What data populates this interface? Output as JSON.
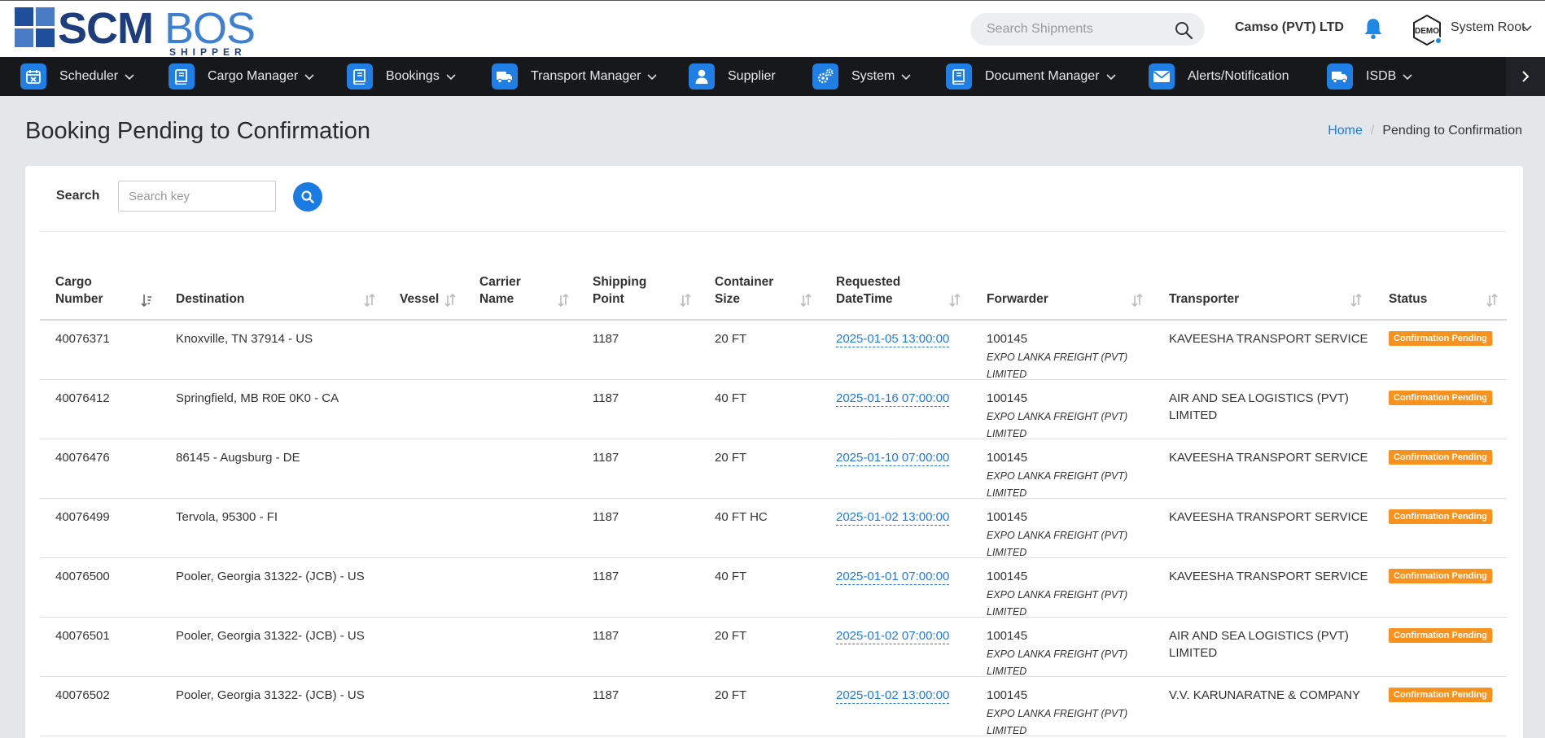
{
  "header": {
    "logo_main": "SCM",
    "logo_second": "BOS",
    "logo_sub": "SHIPPER",
    "search_placeholder": "Search Shipments",
    "company": "Camso (PVT) LTD",
    "demo_label": "DEMO",
    "user_name": "System Root"
  },
  "nav": {
    "items": [
      {
        "label": "Scheduler",
        "icon": "calendar-icon",
        "has_chevron": true
      },
      {
        "label": "Cargo Manager",
        "icon": "book-icon",
        "has_chevron": true
      },
      {
        "label": "Bookings",
        "icon": "book-icon",
        "has_chevron": true
      },
      {
        "label": "Transport Manager",
        "icon": "truck-icon",
        "has_chevron": true
      },
      {
        "label": "Supplier",
        "icon": "user-icon",
        "has_chevron": false
      },
      {
        "label": "System",
        "icon": "gears-icon",
        "has_chevron": true
      },
      {
        "label": "Document Manager",
        "icon": "book-icon",
        "has_chevron": true
      },
      {
        "label": "Alerts/Notification",
        "icon": "envelope-icon",
        "has_chevron": false
      },
      {
        "label": "ISDB",
        "icon": "truck-icon",
        "has_chevron": true
      }
    ]
  },
  "page": {
    "title": "Booking Pending to Confirmation",
    "breadcrumb_home": "Home",
    "breadcrumb_current": "Pending to Confirmation"
  },
  "search": {
    "label": "Search",
    "placeholder": "Search key"
  },
  "table": {
    "columns": [
      {
        "l1": "Cargo",
        "l2": "Number"
      },
      {
        "l1": "",
        "l2": "Destination"
      },
      {
        "l1": "",
        "l2": "Vessel"
      },
      {
        "l1": "Carrier",
        "l2": "Name"
      },
      {
        "l1": "Shipping",
        "l2": "Point"
      },
      {
        "l1": "Container",
        "l2": "Size"
      },
      {
        "l1": "Requested",
        "l2": "DateTime"
      },
      {
        "l1": "",
        "l2": "Forwarder"
      },
      {
        "l1": "",
        "l2": "Transporter"
      },
      {
        "l1": "",
        "l2": "Status"
      }
    ],
    "rows": [
      {
        "cargo": "40076371",
        "destination": "Knoxville, TN 37914 - US",
        "vessel": "",
        "carrier": "",
        "shipping": "1187",
        "size": "20 FT",
        "datetime": "2025-01-05 13:00:00",
        "fwd_code": "100145",
        "fwd_name1": "EXPO LANKA FREIGHT (PVT)",
        "fwd_name2": "LIMITED",
        "trans1": "KAVEESHA TRANSPORT SERVICE",
        "trans2": "",
        "status": "Confirmation Pending"
      },
      {
        "cargo": "40076412",
        "destination": "Springfield, MB R0E 0K0 - CA",
        "vessel": "",
        "carrier": "",
        "shipping": "1187",
        "size": "40 FT",
        "datetime": "2025-01-16 07:00:00",
        "fwd_code": "100145",
        "fwd_name1": "EXPO LANKA FREIGHT (PVT)",
        "fwd_name2": "LIMITED",
        "trans1": "AIR AND SEA LOGISTICS (PVT)",
        "trans2": "LIMITED",
        "status": "Confirmation Pending"
      },
      {
        "cargo": "40076476",
        "destination": "86145 - Augsburg - DE",
        "vessel": "",
        "carrier": "",
        "shipping": "1187",
        "size": "20 FT",
        "datetime": "2025-01-10 07:00:00",
        "fwd_code": "100145",
        "fwd_name1": "EXPO LANKA FREIGHT (PVT)",
        "fwd_name2": "LIMITED",
        "trans1": "KAVEESHA TRANSPORT SERVICE",
        "trans2": "",
        "status": "Confirmation Pending"
      },
      {
        "cargo": "40076499",
        "destination": "Tervola, 95300 - FI",
        "vessel": "",
        "carrier": "",
        "shipping": "1187",
        "size": "40 FT HC",
        "datetime": "2025-01-02 13:00:00",
        "fwd_code": "100145",
        "fwd_name1": "EXPO LANKA FREIGHT (PVT)",
        "fwd_name2": "LIMITED",
        "trans1": "KAVEESHA TRANSPORT SERVICE",
        "trans2": "",
        "status": "Confirmation Pending"
      },
      {
        "cargo": "40076500",
        "destination": "Pooler, Georgia 31322- (JCB) - US",
        "vessel": "",
        "carrier": "",
        "shipping": "1187",
        "size": "40 FT",
        "datetime": "2025-01-01 07:00:00",
        "fwd_code": "100145",
        "fwd_name1": "EXPO LANKA FREIGHT (PVT)",
        "fwd_name2": "LIMITED",
        "trans1": "KAVEESHA TRANSPORT SERVICE",
        "trans2": "",
        "status": "Confirmation Pending"
      },
      {
        "cargo": "40076501",
        "destination": "Pooler, Georgia 31322- (JCB) - US",
        "vessel": "",
        "carrier": "",
        "shipping": "1187",
        "size": "20 FT",
        "datetime": "2025-01-02 07:00:00",
        "fwd_code": "100145",
        "fwd_name1": "EXPO LANKA FREIGHT (PVT)",
        "fwd_name2": "LIMITED",
        "trans1": "AIR AND SEA LOGISTICS (PVT)",
        "trans2": "LIMITED",
        "status": "Confirmation Pending"
      },
      {
        "cargo": "40076502",
        "destination": "Pooler, Georgia 31322- (JCB) - US",
        "vessel": "",
        "carrier": "",
        "shipping": "1187",
        "size": "20 FT",
        "datetime": "2025-01-02 13:00:00",
        "fwd_code": "100145",
        "fwd_name1": "EXPO LANKA FREIGHT (PVT)",
        "fwd_name2": "LIMITED",
        "trans1": "V.V. KARUNARATNE & COMPANY",
        "trans2": "",
        "status": "Confirmation Pending"
      }
    ]
  },
  "colors": {
    "nav_bg": "#16181b",
    "accent_blue": "#1f7fe5",
    "status_orange": "#f7921e",
    "page_bg": "#e4e7ea"
  }
}
